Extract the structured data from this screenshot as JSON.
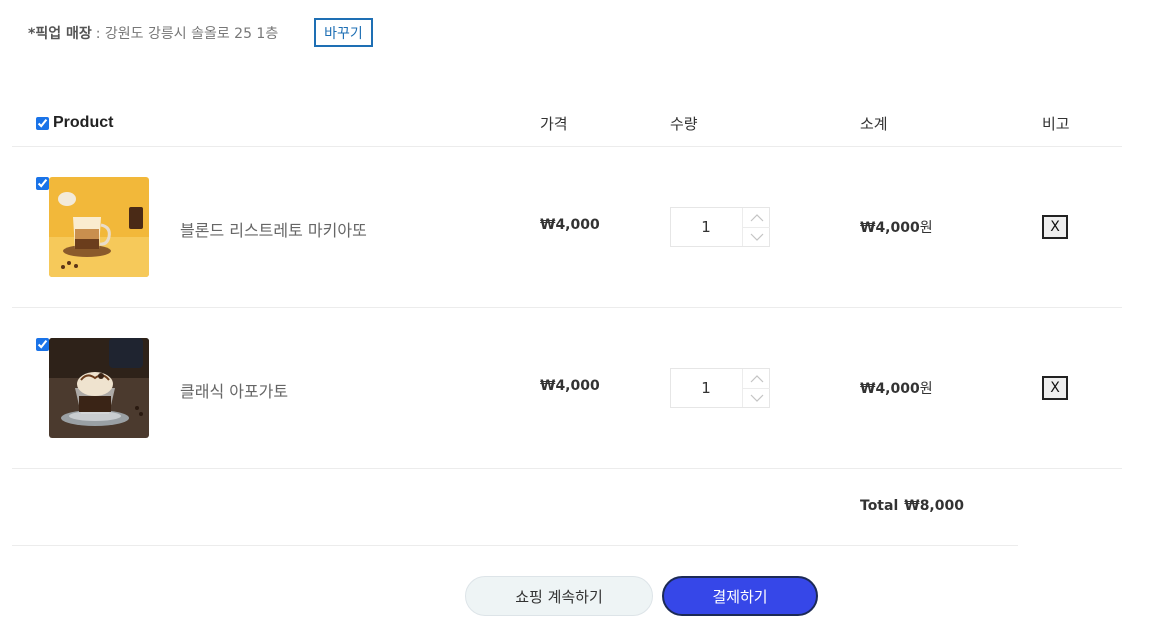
{
  "pickup": {
    "label": "*픽업 매장",
    "address": ": 강원도 강릉시 솔올로 25 1층",
    "change_label": "바꾸기"
  },
  "table": {
    "headers": {
      "product": "Product",
      "price": "가격",
      "quantity": "수량",
      "subtotal": "소계",
      "note": "비고"
    },
    "all_checked": true,
    "items": [
      {
        "checked": true,
        "name": "블론드 리스트레토 마키아또",
        "price": "₩4,000",
        "quantity": "1",
        "subtotal": "₩4,000",
        "subtotal_unit": "원",
        "remove_label": "X",
        "image": "macchiato-photo"
      },
      {
        "checked": true,
        "name": "클래식 아포가토",
        "price": "₩4,000",
        "quantity": "1",
        "subtotal": "₩4,000",
        "subtotal_unit": "원",
        "remove_label": "X",
        "image": "affogato-photo"
      }
    ]
  },
  "summary": {
    "total_label": "Total",
    "total_value": "₩8,000"
  },
  "actions": {
    "continue_label": "쇼핑 계속하기",
    "checkout_label": "결제하기"
  },
  "colors": {
    "accent_blue": "#1e6fb4",
    "checkout_bg": "#3647e8",
    "checkbox_blue": "#1a73e8"
  },
  "icons": {
    "qty_up": "chevron-up-icon",
    "qty_down": "chevron-down-icon"
  }
}
